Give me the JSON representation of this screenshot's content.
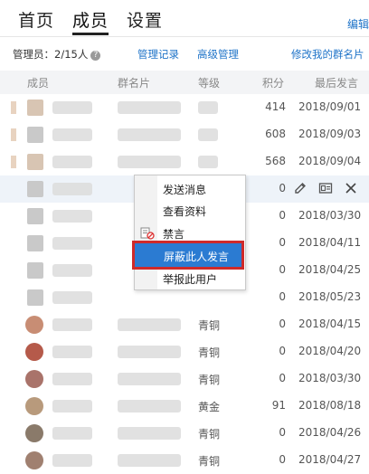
{
  "tabs": [
    {
      "label": "首页"
    },
    {
      "label": "成员"
    },
    {
      "label": "设置"
    }
  ],
  "edit_label": "编辑",
  "toolbar": {
    "admin_count": "管理员：2/15人",
    "manage_log": "管理记录",
    "advanced_manage": "高级管理",
    "edit_my_card": "修改我的群名片"
  },
  "columns": {
    "member": "成员",
    "card": "群名片",
    "level": "等级",
    "score": "积分",
    "last_post": "最后发言"
  },
  "rows": [
    {
      "level": "",
      "score": "414",
      "date": "2018/09/01"
    },
    {
      "level": "",
      "score": "608",
      "date": "2018/09/03"
    },
    {
      "level": "",
      "score": "568",
      "date": "2018/09/04"
    },
    {
      "level": "",
      "score": "0",
      "date": ""
    },
    {
      "level": "",
      "score": "0",
      "date": "2018/03/30"
    },
    {
      "level": "",
      "score": "0",
      "date": "2018/04/11"
    },
    {
      "level": "",
      "score": "0",
      "date": "2018/04/25"
    },
    {
      "level": "",
      "score": "0",
      "date": "2018/05/23"
    },
    {
      "level": "青铜",
      "score": "0",
      "date": "2018/04/15"
    },
    {
      "level": "青铜",
      "score": "0",
      "date": "2018/04/20"
    },
    {
      "level": "青铜",
      "score": "0",
      "date": "2018/03/30"
    },
    {
      "level": "黄金",
      "score": "91",
      "date": "2018/08/18"
    },
    {
      "level": "青铜",
      "score": "0",
      "date": "2018/04/26"
    },
    {
      "level": "青铜",
      "score": "0",
      "date": "2018/04/27"
    }
  ],
  "context_menu": {
    "send_message": "发送消息",
    "view_profile": "查看资料",
    "mute": "禁言",
    "block_messages": "屏蔽此人发言",
    "report_user": "举报此用户"
  },
  "colors": {
    "link": "#1e73c8",
    "highlight_bg": "#2b7bd2",
    "highlight_border": "#cf2a2a"
  }
}
